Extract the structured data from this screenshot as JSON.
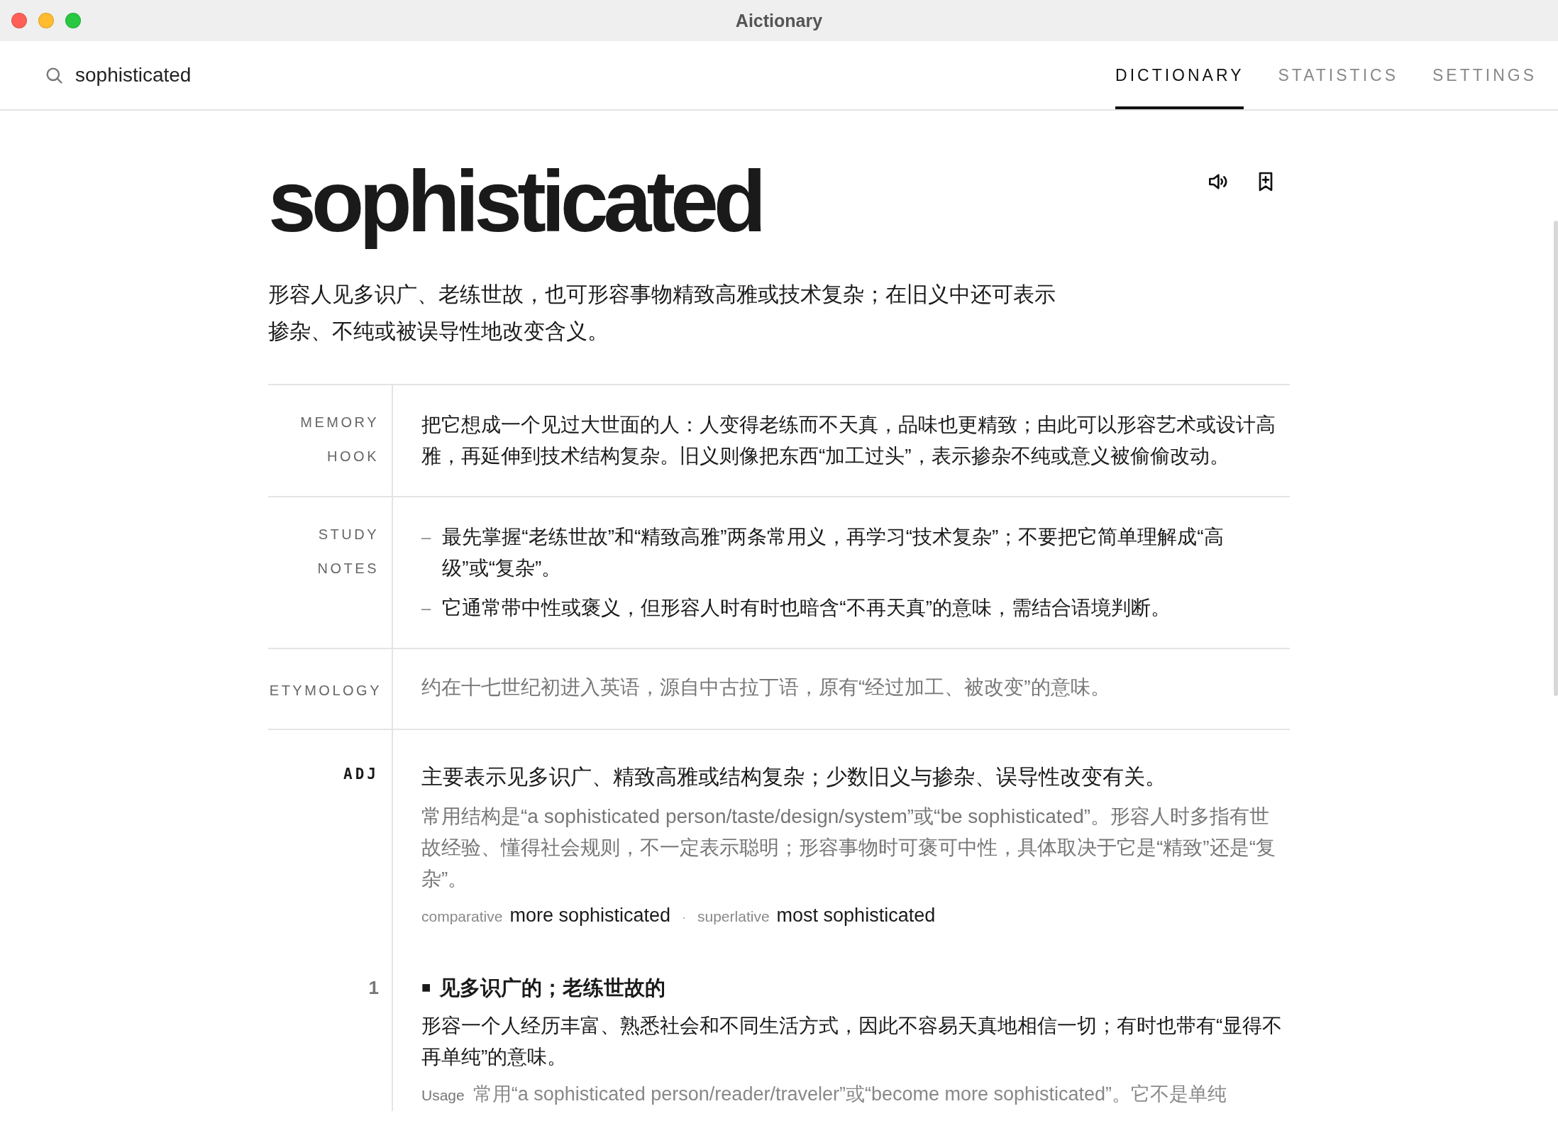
{
  "window": {
    "title": "Aictionary"
  },
  "search": {
    "value": "sophisticated"
  },
  "tabs": [
    {
      "label": "DICTIONARY",
      "selected": true
    },
    {
      "label": "STATISTICS",
      "selected": false
    },
    {
      "label": "SETTINGS",
      "selected": false
    }
  ],
  "entry": {
    "headword": "sophisticated",
    "definition": "形容人见多识广、老练世故，也可形容事物精致高雅或技术复杂；在旧义中还可表示掺杂、不纯或被误导性地改变含义。",
    "sections": [
      {
        "kind": "paragraph",
        "label": "MEMORY HOOK",
        "text": "把它想成一个见过大世面的人：人变得老练而不天真，品味也更精致；由此可以形容艺术或设计高雅，再延伸到技术结构复杂。旧义则像把东西“加工过头”，表示掺杂不纯或意义被偷偷改动。"
      },
      {
        "kind": "bullets",
        "label": "STUDY NOTES",
        "items": [
          {
            "marker": "–",
            "text": "最先掌握“老练世故”和“精致高雅”两条常用义，再学习“技术复杂”；不要把它简单理解成“高级”或“复杂”。"
          },
          {
            "marker": "–",
            "text": "它通常带中性或褒义，但形容人时有时也暗含“不再天真”的意味，需结合语境判断。"
          }
        ]
      },
      {
        "kind": "muted",
        "label": "ETYMOLOGY",
        "text": "约在十七世纪初进入英语，源自中古拉丁语，原有“经过加工、被改变”的意味。"
      }
    ],
    "pos": {
      "label": "ADJ",
      "summary": "主要表示见多识广、精致高雅或结构复杂；少数旧义与掺杂、误导性改变有关。",
      "note": "常用结构是“a sophisticated person/taste/design/system”或“be sophisticated”。形容人时多指有世故经验、懂得社会规则，不一定表示聪明；形容事物时可褒可中性，具体取决于它是“精致”还是“复杂”。",
      "forms": [
        {
          "label": "comparative",
          "value": "more sophisticated"
        },
        {
          "label": "superlative",
          "value": "most sophisticated"
        }
      ],
      "separator": "·"
    },
    "senses": [
      {
        "number": "1",
        "marker": "■",
        "title": "见多识广的；老练世故的",
        "definition": "形容一个人经历丰富、熟悉社会和不同生活方式，因此不容易天真地相信一切；有时也带有“显得不再单纯”的意味。",
        "usage_label": "Usage",
        "usage": "常用“a sophisticated person/reader/traveler”或“become more sophisticated”。它不是单纯"
      }
    ]
  }
}
